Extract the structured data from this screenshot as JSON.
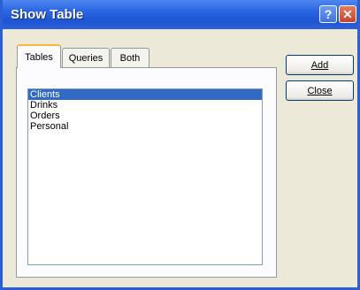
{
  "window": {
    "title": "Show Table",
    "help_glyph": "?",
    "close_glyph": "✕"
  },
  "tabs": [
    {
      "label": "Tables",
      "active": true
    },
    {
      "label": "Queries",
      "active": false
    },
    {
      "label": "Both",
      "active": false
    }
  ],
  "list": {
    "items": [
      "Clients",
      "Drinks",
      "Orders",
      "Personal"
    ],
    "selected": "Clients"
  },
  "buttons": {
    "add_label": "Add",
    "close_label": "Close"
  }
}
